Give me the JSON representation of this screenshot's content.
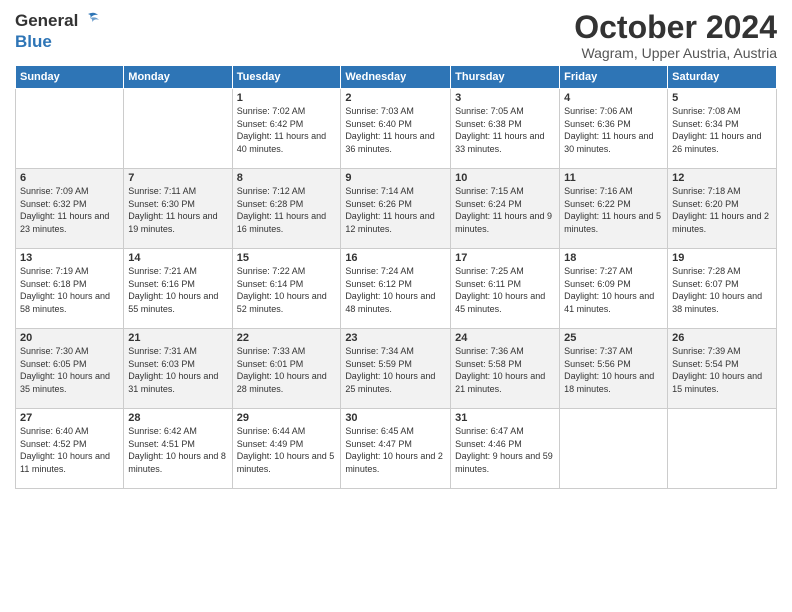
{
  "logo": {
    "general": "General",
    "blue": "Blue"
  },
  "title": "October 2024",
  "location": "Wagram, Upper Austria, Austria",
  "days_header": [
    "Sunday",
    "Monday",
    "Tuesday",
    "Wednesday",
    "Thursday",
    "Friday",
    "Saturday"
  ],
  "weeks": [
    [
      {
        "day": "",
        "info": ""
      },
      {
        "day": "",
        "info": ""
      },
      {
        "day": "1",
        "info": "Sunrise: 7:02 AM\nSunset: 6:42 PM\nDaylight: 11 hours and 40 minutes."
      },
      {
        "day": "2",
        "info": "Sunrise: 7:03 AM\nSunset: 6:40 PM\nDaylight: 11 hours and 36 minutes."
      },
      {
        "day": "3",
        "info": "Sunrise: 7:05 AM\nSunset: 6:38 PM\nDaylight: 11 hours and 33 minutes."
      },
      {
        "day": "4",
        "info": "Sunrise: 7:06 AM\nSunset: 6:36 PM\nDaylight: 11 hours and 30 minutes."
      },
      {
        "day": "5",
        "info": "Sunrise: 7:08 AM\nSunset: 6:34 PM\nDaylight: 11 hours and 26 minutes."
      }
    ],
    [
      {
        "day": "6",
        "info": "Sunrise: 7:09 AM\nSunset: 6:32 PM\nDaylight: 11 hours and 23 minutes."
      },
      {
        "day": "7",
        "info": "Sunrise: 7:11 AM\nSunset: 6:30 PM\nDaylight: 11 hours and 19 minutes."
      },
      {
        "day": "8",
        "info": "Sunrise: 7:12 AM\nSunset: 6:28 PM\nDaylight: 11 hours and 16 minutes."
      },
      {
        "day": "9",
        "info": "Sunrise: 7:14 AM\nSunset: 6:26 PM\nDaylight: 11 hours and 12 minutes."
      },
      {
        "day": "10",
        "info": "Sunrise: 7:15 AM\nSunset: 6:24 PM\nDaylight: 11 hours and 9 minutes."
      },
      {
        "day": "11",
        "info": "Sunrise: 7:16 AM\nSunset: 6:22 PM\nDaylight: 11 hours and 5 minutes."
      },
      {
        "day": "12",
        "info": "Sunrise: 7:18 AM\nSunset: 6:20 PM\nDaylight: 11 hours and 2 minutes."
      }
    ],
    [
      {
        "day": "13",
        "info": "Sunrise: 7:19 AM\nSunset: 6:18 PM\nDaylight: 10 hours and 58 minutes."
      },
      {
        "day": "14",
        "info": "Sunrise: 7:21 AM\nSunset: 6:16 PM\nDaylight: 10 hours and 55 minutes."
      },
      {
        "day": "15",
        "info": "Sunrise: 7:22 AM\nSunset: 6:14 PM\nDaylight: 10 hours and 52 minutes."
      },
      {
        "day": "16",
        "info": "Sunrise: 7:24 AM\nSunset: 6:12 PM\nDaylight: 10 hours and 48 minutes."
      },
      {
        "day": "17",
        "info": "Sunrise: 7:25 AM\nSunset: 6:11 PM\nDaylight: 10 hours and 45 minutes."
      },
      {
        "day": "18",
        "info": "Sunrise: 7:27 AM\nSunset: 6:09 PM\nDaylight: 10 hours and 41 minutes."
      },
      {
        "day": "19",
        "info": "Sunrise: 7:28 AM\nSunset: 6:07 PM\nDaylight: 10 hours and 38 minutes."
      }
    ],
    [
      {
        "day": "20",
        "info": "Sunrise: 7:30 AM\nSunset: 6:05 PM\nDaylight: 10 hours and 35 minutes."
      },
      {
        "day": "21",
        "info": "Sunrise: 7:31 AM\nSunset: 6:03 PM\nDaylight: 10 hours and 31 minutes."
      },
      {
        "day": "22",
        "info": "Sunrise: 7:33 AM\nSunset: 6:01 PM\nDaylight: 10 hours and 28 minutes."
      },
      {
        "day": "23",
        "info": "Sunrise: 7:34 AM\nSunset: 5:59 PM\nDaylight: 10 hours and 25 minutes."
      },
      {
        "day": "24",
        "info": "Sunrise: 7:36 AM\nSunset: 5:58 PM\nDaylight: 10 hours and 21 minutes."
      },
      {
        "day": "25",
        "info": "Sunrise: 7:37 AM\nSunset: 5:56 PM\nDaylight: 10 hours and 18 minutes."
      },
      {
        "day": "26",
        "info": "Sunrise: 7:39 AM\nSunset: 5:54 PM\nDaylight: 10 hours and 15 minutes."
      }
    ],
    [
      {
        "day": "27",
        "info": "Sunrise: 6:40 AM\nSunset: 4:52 PM\nDaylight: 10 hours and 11 minutes."
      },
      {
        "day": "28",
        "info": "Sunrise: 6:42 AM\nSunset: 4:51 PM\nDaylight: 10 hours and 8 minutes."
      },
      {
        "day": "29",
        "info": "Sunrise: 6:44 AM\nSunset: 4:49 PM\nDaylight: 10 hours and 5 minutes."
      },
      {
        "day": "30",
        "info": "Sunrise: 6:45 AM\nSunset: 4:47 PM\nDaylight: 10 hours and 2 minutes."
      },
      {
        "day": "31",
        "info": "Sunrise: 6:47 AM\nSunset: 4:46 PM\nDaylight: 9 hours and 59 minutes."
      },
      {
        "day": "",
        "info": ""
      },
      {
        "day": "",
        "info": ""
      }
    ]
  ]
}
